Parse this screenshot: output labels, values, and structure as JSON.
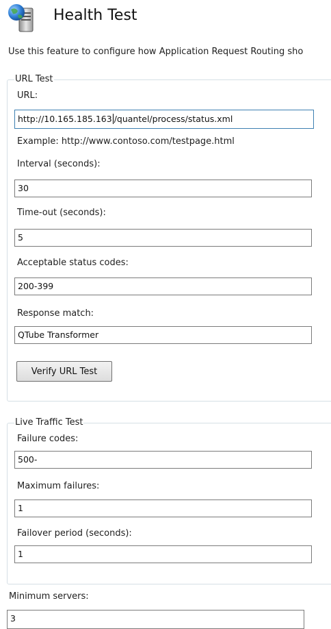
{
  "header": {
    "title": "Health Test",
    "icon": "server-globe-icon"
  },
  "description": "Use this feature to configure how Application Request Routing sho",
  "url_test": {
    "legend": "URL Test",
    "url_label": "URL:",
    "url_value_before_caret": "http://10.165.185.163",
    "url_value_after_caret": "/quantel/process/status.xml",
    "example": "Example: http://www.contoso.com/testpage.html",
    "interval_label": "Interval (seconds):",
    "interval_value": "30",
    "timeout_label": "Time-out (seconds):",
    "timeout_value": "5",
    "status_codes_label": "Acceptable status codes:",
    "status_codes_value": "200-399",
    "response_match_label": "Response match:",
    "response_match_value": "QTube Transformer",
    "verify_button": "Verify URL Test"
  },
  "live_traffic_test": {
    "legend": "Live Traffic Test",
    "failure_codes_label": "Failure codes:",
    "failure_codes_value": "500-",
    "max_failures_label": "Maximum failures:",
    "max_failures_value": "1",
    "failover_label": "Failover period (seconds):",
    "failover_value": "1"
  },
  "minimum_servers": {
    "label": "Minimum servers:",
    "value": "3"
  },
  "colors": {
    "focus_border": "#3c7fb1",
    "group_border": "#d5dfe5"
  }
}
